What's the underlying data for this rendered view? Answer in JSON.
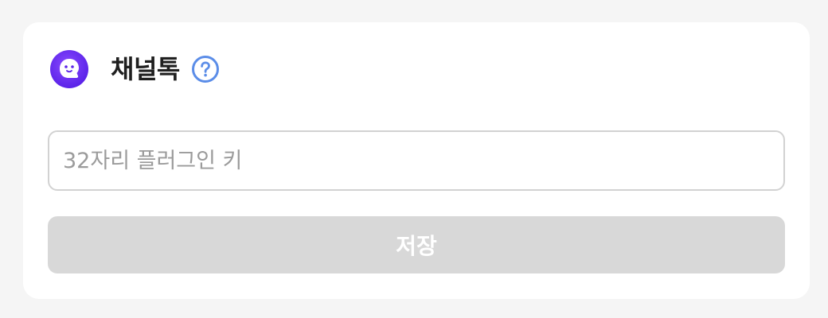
{
  "card": {
    "title": "채널톡",
    "logo_icon": "channeltalk-logo-icon",
    "help_icon": "question-circle-icon"
  },
  "plugin_key_input": {
    "value": "",
    "placeholder": "32자리 플러그인 키"
  },
  "save_button": {
    "label": "저장",
    "state": "disabled"
  },
  "colors": {
    "page_background": "#f5f5f5",
    "card_background": "#ffffff",
    "brand_purple": "#6b2ff5",
    "help_blue": "#5b8de8",
    "button_disabled": "#d8d8d8",
    "input_border": "#d2d2d2",
    "placeholder": "#9b9b9b"
  }
}
